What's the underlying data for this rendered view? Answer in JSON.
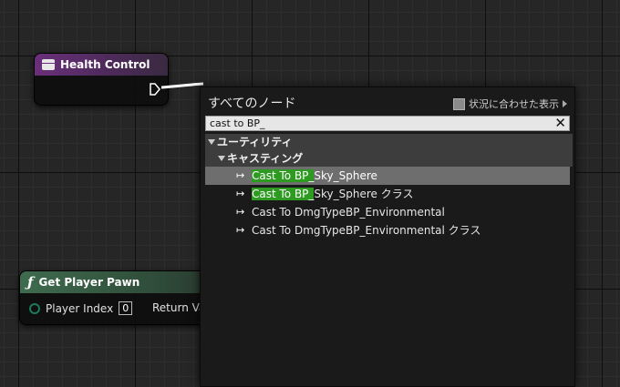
{
  "health_node": {
    "title": "Health Control"
  },
  "pawn_node": {
    "title": "Get Player Pawn",
    "icon": "function-icon",
    "pin_label": "Player Index",
    "pin_value": "0",
    "return_label": "Return Va"
  },
  "menu": {
    "title": "すべてのノード",
    "context_label": "状況に合わせた表示",
    "search_value": "cast to BP_",
    "categories": [
      "ユーティリティ",
      "キャスティング"
    ],
    "items": [
      {
        "match": "Cast To BP_",
        "rest": "Sky_Sphere",
        "selected": true
      },
      {
        "match": "Cast To BP_",
        "rest": "Sky_Sphere クラス",
        "selected": false
      },
      {
        "match": "",
        "rest": "Cast To DmgTypeBP_Environmental",
        "selected": false
      },
      {
        "match": "",
        "rest": "Cast To DmgTypeBP_Environmental クラス",
        "selected": false
      }
    ]
  },
  "colors": {
    "highlight": "#2f9a22",
    "macro_header": "#6a2f7a",
    "function_header": "#3f6b4e"
  }
}
